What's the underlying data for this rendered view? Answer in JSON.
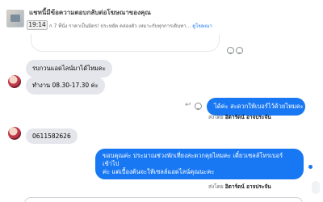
{
  "header": {
    "title": "แชทนี้มีข้อความตอบกลับต่อโฆษณาของคุณ",
    "time": "19:14",
    "preview_text": "ก 7 ที่นั่ง ราคาเป็นมิตร! ประหยัด คล่องตัว เหมาะกับทุกการเดินทา...",
    "preview_link": "ดูโฆษณา"
  },
  "messages": [
    {
      "side": "in",
      "text": "รบกวนแอดไลน์มาได้ไหมคะ"
    },
    {
      "side": "in",
      "text": "ทำงาน  08.30-17.30  ค่ะ"
    },
    {
      "side": "out",
      "text": "ได้ค่ะ สะดวกให้เบอร์ไว้ด้วยไหมคะ"
    },
    {
      "side": "in",
      "text": "0611582626"
    },
    {
      "side": "out",
      "line1": "ขอบคุณค่ะ ประมาณช่วงพักเที่ยงสะดวกคุยไหมคะ เดี๋ยวเซลล์โทรเบอร์เข้าไป",
      "line2": "ค่ะ แต่เบื้องต้นจะให้เซลล์แอดไลน์คุณนะคะ"
    }
  ],
  "sent_by": {
    "prefix": "ส่งโดย",
    "name": "อิตาร์ดน์ อาจประจัน"
  }
}
